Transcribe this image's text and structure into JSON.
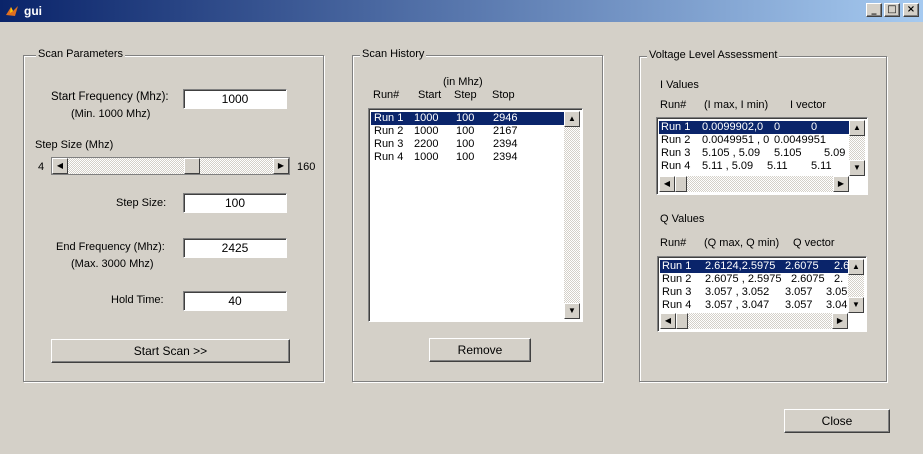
{
  "window": {
    "title": "gui",
    "min": "_",
    "max": "□",
    "close": "×"
  },
  "scan_params": {
    "title": "Scan Parameters",
    "start_freq_label": "Start Frequency (Mhz):",
    "start_freq_min": "(Min. 1000 Mhz)",
    "start_freq_value": "1000",
    "step_size_mhz_label": "Step Size (Mhz)",
    "slider_min": "4",
    "slider_max": "160",
    "slider_value": 100,
    "step_size_label": "Step Size:",
    "step_size_value": "100",
    "end_freq_label": "End Frequency (Mhz):",
    "end_freq_max": "(Max. 3000 Mhz)",
    "end_freq_value": "2425",
    "hold_time_label": "Hold Time:",
    "hold_time_value": "40",
    "start_scan": "Start Scan >>"
  },
  "scan_history": {
    "title": "Scan History",
    "units": "(in Mhz)",
    "headers": [
      "Run#",
      "Start",
      "Step",
      "Stop"
    ],
    "rows": [
      [
        "Run 1",
        "1000",
        "100",
        "2946"
      ],
      [
        "Run 2",
        "1000",
        "100",
        "2167"
      ],
      [
        "Run 3",
        "2200",
        "100",
        "2394"
      ],
      [
        "Run 4",
        "1000",
        "100",
        "2394"
      ]
    ],
    "remove": "Remove"
  },
  "voltage": {
    "title": "Voltage Level Assessment",
    "i_title": "I Values",
    "i_headers": [
      "Run#",
      "(I max, I min)",
      "I vector"
    ],
    "i_rows": [
      [
        "Run 1",
        "0.0099902,0",
        "0",
        "0"
      ],
      [
        "Run 2",
        "0.0049951 , 0",
        "0.0049951",
        ""
      ],
      [
        "Run 3",
        "5.105 , 5.09",
        "5.105",
        "5.09"
      ],
      [
        "Run 4",
        "5.11 , 5.09",
        "5.11",
        "5.11"
      ]
    ],
    "q_title": "Q Values",
    "q_headers": [
      "Run#",
      "(Q max, Q min)",
      "Q vector"
    ],
    "q_rows": [
      [
        "Run 1",
        "2.6124,2.5975",
        "2.6075",
        "2.6"
      ],
      [
        "Run 2",
        "2.6075 , 2.5975",
        "2.6075",
        "2."
      ],
      [
        "Run 3",
        "3.057 , 3.052",
        "3.057",
        "3.05"
      ],
      [
        "Run 4",
        "3.057 , 3.047",
        "3.057",
        "3.04"
      ]
    ]
  },
  "close": "Close"
}
